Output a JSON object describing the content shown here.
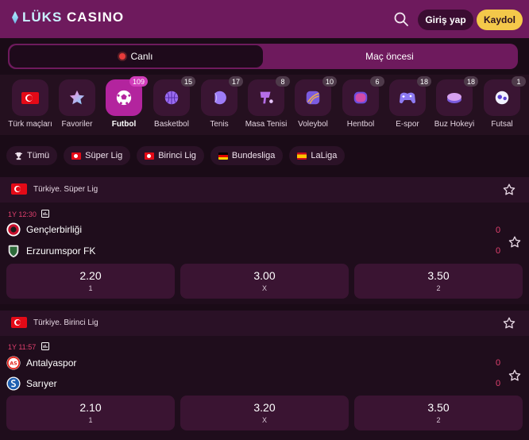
{
  "header": {
    "logo_a": "LÜKS",
    "logo_b": "CASINO",
    "login_label": "Giriş yap",
    "signup_label": "Kaydol"
  },
  "mode": {
    "tabs": [
      {
        "label": "Canlı",
        "active": true
      },
      {
        "label": "Maç öncesi",
        "active": false
      }
    ]
  },
  "sports": [
    {
      "label": "Türk maçları",
      "badge": "",
      "icon": "turkey-flag-icon"
    },
    {
      "label": "Favoriler",
      "badge": "",
      "icon": "star-icon"
    },
    {
      "label": "Futbol",
      "badge": "109",
      "icon": "soccer-ball-icon",
      "active": true
    },
    {
      "label": "Basketbol",
      "badge": "15",
      "icon": "basketball-icon"
    },
    {
      "label": "Tenis",
      "badge": "17",
      "icon": "tennis-ball-icon"
    },
    {
      "label": "Masa Tenisi",
      "badge": "8",
      "icon": "table-tennis-icon"
    },
    {
      "label": "Voleybol",
      "badge": "10",
      "icon": "volleyball-icon"
    },
    {
      "label": "Hentbol",
      "badge": "6",
      "icon": "handball-icon"
    },
    {
      "label": "E-spor",
      "badge": "18",
      "icon": "gamepad-icon"
    },
    {
      "label": "Buz Hokeyi",
      "badge": "18",
      "icon": "hockey-puck-icon"
    },
    {
      "label": "Futsal",
      "badge": "1",
      "icon": "futsal-ball-icon"
    }
  ],
  "leagues": [
    {
      "label": "Tümü",
      "icon": "trophy-icon"
    },
    {
      "label": "Süper Lig",
      "flag": "tr"
    },
    {
      "label": "Birinci Lig",
      "flag": "tr"
    },
    {
      "label": "Bundesliga",
      "flag": "de"
    },
    {
      "label": "LaLiga",
      "flag": "es"
    }
  ],
  "matches": [
    {
      "league": "Türkiye. Süper Lig",
      "time": "1Y 12:30",
      "home": {
        "name": "Gençlerbirliği",
        "score": "0",
        "color": "#c8102e"
      },
      "away": {
        "name": "Erzurumspor FK",
        "score": "0",
        "color": "#1e5ca8"
      },
      "odds": [
        {
          "value": "2.20",
          "key": "1"
        },
        {
          "value": "3.00",
          "key": "X"
        },
        {
          "value": "3.50",
          "key": "2"
        }
      ]
    },
    {
      "league": "Türkiye. Birinci Lig",
      "time": "1Y 11:57",
      "home": {
        "name": "Antalyaspor",
        "score": "0",
        "color": "#e2231a"
      },
      "away": {
        "name": "Sarıyer",
        "score": "0",
        "color": "#1f5fb0"
      },
      "odds": [
        {
          "value": "2.10",
          "key": "1"
        },
        {
          "value": "3.20",
          "key": "X"
        },
        {
          "value": "3.50",
          "key": "2"
        }
      ]
    }
  ],
  "colors": {
    "header_bg": "#6e1a5d",
    "accent_pink": "#b3249e",
    "signup_yellow": "#f4c84a",
    "live_red": "#e0406e"
  }
}
